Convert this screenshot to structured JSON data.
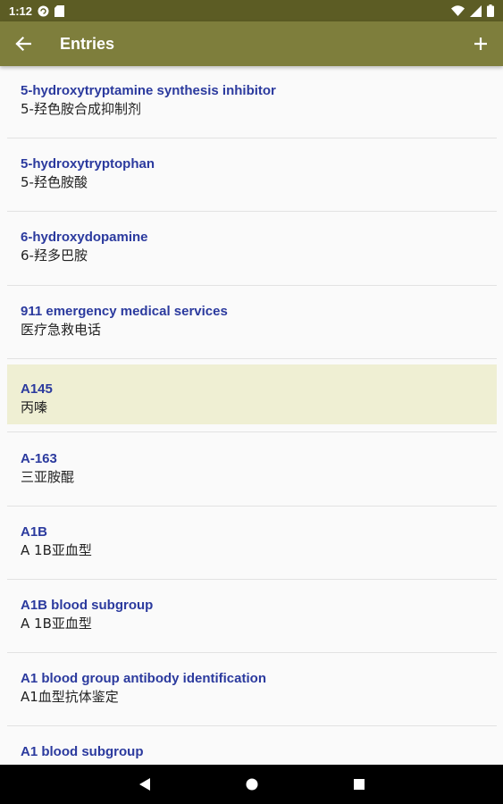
{
  "status_bar": {
    "time": "1:12",
    "icons": [
      "sync-icon",
      "sd-card-icon",
      "wifi-icon",
      "signal-icon",
      "battery-icon"
    ]
  },
  "app_bar": {
    "title": "Entries",
    "back_icon": "arrow-back-icon",
    "add_icon": "add-icon",
    "background": "#7e7e3c"
  },
  "entries": [
    {
      "term": "5-hydroxytryptamine synthesis inhibitor",
      "translation": "5-羟色胺合成抑制剂"
    },
    {
      "term": "5-hydroxytryptophan",
      "translation": "5-羟色胺酸"
    },
    {
      "term": "6-hydroxydopamine",
      "translation": "6-羟多巴胺"
    },
    {
      "term": "911 emergency medical services",
      "translation": "医疗急救电话"
    },
    {
      "term": "A145",
      "translation": "丙嗪"
    },
    {
      "term": "A-163",
      "translation": "三亚胺醌"
    },
    {
      "term": "A1B",
      "translation": "A 1B亚血型"
    },
    {
      "term": "A1B blood subgroup",
      "translation": "A 1B亚血型"
    },
    {
      "term": "A1 blood group antibody identification",
      "translation": "A1血型抗体鉴定"
    },
    {
      "term": "A1 blood subgroup",
      "translation": ""
    }
  ],
  "selected_entry": "A145",
  "colors": {
    "term_text": "#2b3a9e",
    "selected_background": "#efefd3",
    "status_bar": "#5c5c24"
  },
  "nav_bar": {
    "icons": [
      "back-triangle-icon",
      "home-circle-icon",
      "recents-square-icon"
    ]
  }
}
